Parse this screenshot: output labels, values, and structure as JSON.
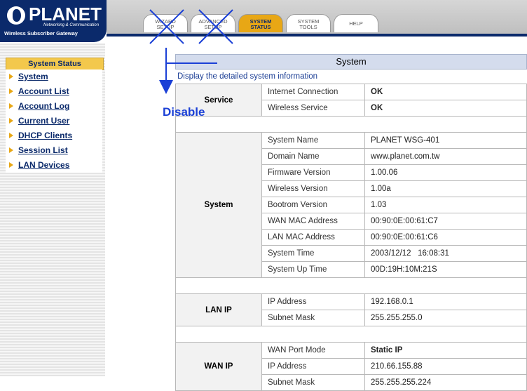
{
  "header": {
    "logo_text": "PLANET",
    "logo_sub1": "Networking & Communication",
    "logo_sub2": "Wireless Subscriber Gateway",
    "tabs": [
      {
        "line1": "WIZARD",
        "line2": "SETUP"
      },
      {
        "line1": "ADVANCED",
        "line2": "SETUP"
      },
      {
        "line1": "SYSTEM",
        "line2": "STATUS"
      },
      {
        "line1": "SYSTEM",
        "line2": "TOOLS"
      },
      {
        "line1": "HELP",
        "line2": ""
      }
    ]
  },
  "sidebar": {
    "title": "System Status",
    "items": [
      {
        "label": "System"
      },
      {
        "label": "Account List"
      },
      {
        "label": "Account Log"
      },
      {
        "label": "Current User"
      },
      {
        "label": "DHCP Clients"
      },
      {
        "label": "Session List"
      },
      {
        "label": "LAN Devices"
      }
    ]
  },
  "annotation": {
    "text": "Disable"
  },
  "main": {
    "title": "System",
    "description": "Display the detailed system information",
    "groups": {
      "service": {
        "label": "Service",
        "rows": [
          {
            "key": "Internet Connection",
            "value": "OK"
          },
          {
            "key": "Wireless Service",
            "value": "OK"
          }
        ]
      },
      "system": {
        "label": "System",
        "rows": [
          {
            "key": "System Name",
            "value": "PLANET WSG-401"
          },
          {
            "key": "Domain Name",
            "value": "www.planet.com.tw"
          },
          {
            "key": "Firmware Version",
            "value": "1.00.06"
          },
          {
            "key": "Wireless Version",
            "value": "1.00a"
          },
          {
            "key": "Bootrom Version",
            "value": "1.03"
          },
          {
            "key": "WAN MAC Address",
            "value": "00:90:0E:00:61:C7"
          },
          {
            "key": "LAN MAC Address",
            "value": "00:90:0E:00:61:C6"
          },
          {
            "key": "System Time",
            "value": "2003/12/12   16:08:31"
          },
          {
            "key": "System Up Time",
            "value": "00D:19H:10M:21S"
          }
        ]
      },
      "lan": {
        "label": "LAN IP",
        "rows": [
          {
            "key": "IP Address",
            "value": "192.168.0.1"
          },
          {
            "key": "Subnet Mask",
            "value": "255.255.255.0"
          }
        ]
      },
      "wan": {
        "label": "WAN IP",
        "rows": [
          {
            "key": "WAN Port Mode",
            "value": "Static IP"
          },
          {
            "key": "IP Address",
            "value": "210.66.155.88"
          },
          {
            "key": "Subnet Mask",
            "value": "255.255.255.224"
          }
        ]
      }
    }
  },
  "colors": {
    "brand_navy": "#0b2a6b",
    "active_tab": "#e8a715",
    "annotation_blue": "#1b40d6"
  }
}
